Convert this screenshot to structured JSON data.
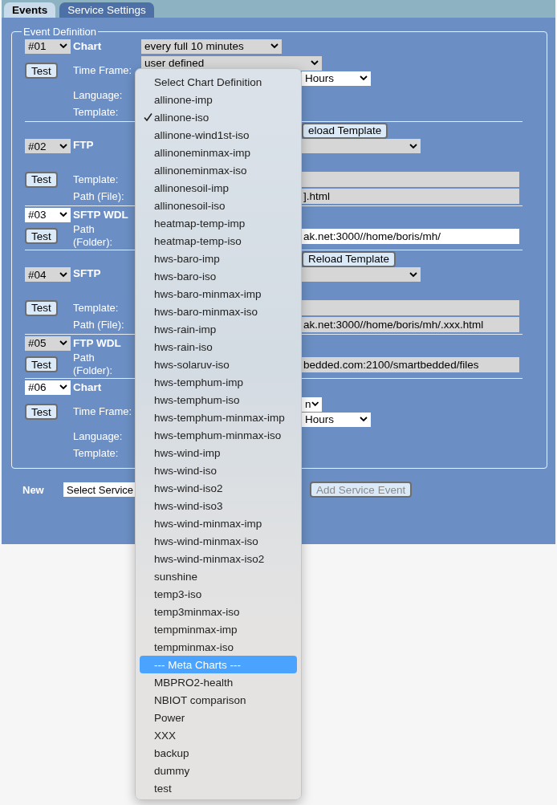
{
  "tabs": [
    {
      "label": "Events",
      "selected": true
    },
    {
      "label": "Service Settings",
      "selected": false
    }
  ],
  "legend": "Event Definition",
  "events": [
    {
      "number": "#01",
      "disabled": true,
      "type": "Chart",
      "rows": [
        {
          "controls": [
            {
              "kind": "schedule-select",
              "value": "every full 10 minutes",
              "disabled": true
            }
          ]
        },
        {
          "test_button": "Test",
          "label": "Time Frame:",
          "controls": [
            {
              "kind": "timeframe-select",
              "value": "user defined",
              "disabled": true
            },
            {
              "kind": "unit-select",
              "value": "Hours",
              "disabled": false
            }
          ]
        },
        {
          "label": "Language:"
        },
        {
          "label": "Template:"
        }
      ]
    },
    {
      "number": "#02",
      "disabled": true,
      "type": "FTP",
      "rows": [
        {
          "controls": [
            {
              "kind": "reload-button",
              "value": "eload Template"
            }
          ]
        },
        {
          "controls": [
            {
              "kind": "template-select",
              "disabled": true
            }
          ]
        },
        {
          "test_button": "Test",
          "label": "Template:",
          "controls": [
            {
              "kind": "text-field",
              "disabled": true
            }
          ]
        },
        {
          "label": "Path (File):",
          "controls": [
            {
              "kind": "text-field",
              "value": "].html",
              "disabled": true
            }
          ]
        }
      ]
    },
    {
      "number": "#03",
      "disabled": false,
      "type": "SFTP WDL",
      "rows": [
        {},
        {
          "test_button": "Test",
          "label": "Path (Folder):",
          "controls": [
            {
              "kind": "text-field",
              "value": "ak.net:3000//home/boris/mh/",
              "disabled": false
            }
          ]
        }
      ]
    },
    {
      "number": "#04",
      "disabled": true,
      "type": "SFTP",
      "rows": [
        {
          "controls": [
            {
              "kind": "reload-button",
              "value": "Reload Template"
            }
          ]
        },
        {
          "controls": [
            {
              "kind": "template-select",
              "disabled": true
            }
          ]
        },
        {
          "test_button": "Test",
          "label": "Template:",
          "controls": [
            {
              "kind": "text-field",
              "disabled": true
            }
          ]
        },
        {
          "label": "Path (File):",
          "controls": [
            {
              "kind": "text-field",
              "value": "ak.net:3000//home/boris/mh/.xxx.html",
              "disabled": true
            }
          ]
        }
      ]
    },
    {
      "number": "#05",
      "disabled": true,
      "type": "FTP WDL",
      "rows": [
        {},
        {
          "test_button": "Test",
          "label": "Path (Folder):",
          "controls": [
            {
              "kind": "text-field",
              "value": "bedded.com:2100/smartbedded/files",
              "disabled": true
            }
          ]
        }
      ]
    },
    {
      "number": "#06",
      "disabled": false,
      "type": "Chart",
      "rows": [
        {},
        {
          "test_button": "Test",
          "label": "Time Frame:",
          "controls": [
            {
              "kind": "select-end",
              "value": "n",
              "disabled": false
            },
            {
              "kind": "unit-select",
              "value": "Hours",
              "disabled": false
            }
          ]
        },
        {
          "label": "Language:"
        },
        {
          "label": "Template:"
        }
      ]
    }
  ],
  "new_row": {
    "label": "New",
    "service_select": "Select Service",
    "add_button": {
      "label": "Add Service Event",
      "disabled": true
    }
  },
  "chart_menu": {
    "items": [
      {
        "label": "Select Chart Definition",
        "checked": false,
        "selected": false
      },
      {
        "label": "allinone-imp",
        "checked": false,
        "selected": false
      },
      {
        "label": "allinone-iso",
        "checked": true,
        "selected": false
      },
      {
        "label": "allinone-wind1st-iso",
        "checked": false,
        "selected": false
      },
      {
        "label": "allinoneminmax-imp",
        "checked": false,
        "selected": false
      },
      {
        "label": "allinoneminmax-iso",
        "checked": false,
        "selected": false
      },
      {
        "label": "allinonesoil-imp",
        "checked": false,
        "selected": false
      },
      {
        "label": "allinonesoil-iso",
        "checked": false,
        "selected": false
      },
      {
        "label": "heatmap-temp-imp",
        "checked": false,
        "selected": false
      },
      {
        "label": "heatmap-temp-iso",
        "checked": false,
        "selected": false
      },
      {
        "label": "hws-baro-imp",
        "checked": false,
        "selected": false
      },
      {
        "label": "hws-baro-iso",
        "checked": false,
        "selected": false
      },
      {
        "label": "hws-baro-minmax-imp",
        "checked": false,
        "selected": false
      },
      {
        "label": "hws-baro-minmax-iso",
        "checked": false,
        "selected": false
      },
      {
        "label": "hws-rain-imp",
        "checked": false,
        "selected": false
      },
      {
        "label": "hws-rain-iso",
        "checked": false,
        "selected": false
      },
      {
        "label": "hws-solaruv-iso",
        "checked": false,
        "selected": false
      },
      {
        "label": "hws-temphum-imp",
        "checked": false,
        "selected": false
      },
      {
        "label": "hws-temphum-iso",
        "checked": false,
        "selected": false
      },
      {
        "label": "hws-temphum-minmax-imp",
        "checked": false,
        "selected": false
      },
      {
        "label": "hws-temphum-minmax-iso",
        "checked": false,
        "selected": false
      },
      {
        "label": "hws-wind-imp",
        "checked": false,
        "selected": false
      },
      {
        "label": "hws-wind-iso",
        "checked": false,
        "selected": false
      },
      {
        "label": "hws-wind-iso2",
        "checked": false,
        "selected": false
      },
      {
        "label": "hws-wind-iso3",
        "checked": false,
        "selected": false
      },
      {
        "label": "hws-wind-minmax-imp",
        "checked": false,
        "selected": false
      },
      {
        "label": "hws-wind-minmax-iso",
        "checked": false,
        "selected": false
      },
      {
        "label": "hws-wind-minmax-iso2",
        "checked": false,
        "selected": false
      },
      {
        "label": "sunshine",
        "checked": false,
        "selected": false
      },
      {
        "label": "temp3-iso",
        "checked": false,
        "selected": false
      },
      {
        "label": "temp3minmax-iso",
        "checked": false,
        "selected": false
      },
      {
        "label": "tempminmax-imp",
        "checked": false,
        "selected": false
      },
      {
        "label": "tempminmax-iso",
        "checked": false,
        "selected": false
      },
      {
        "label": "--- Meta Charts ---",
        "checked": false,
        "selected": true
      },
      {
        "label": "MBPRO2-health",
        "checked": false,
        "selected": false
      },
      {
        "label": "NBIOT comparison",
        "checked": false,
        "selected": false
      },
      {
        "label": "Power",
        "checked": false,
        "selected": false
      },
      {
        "label": "XXX",
        "checked": false,
        "selected": false
      },
      {
        "label": "backup",
        "checked": false,
        "selected": false
      },
      {
        "label": "dummy",
        "checked": false,
        "selected": false
      },
      {
        "label": "test",
        "checked": false,
        "selected": false
      }
    ]
  }
}
